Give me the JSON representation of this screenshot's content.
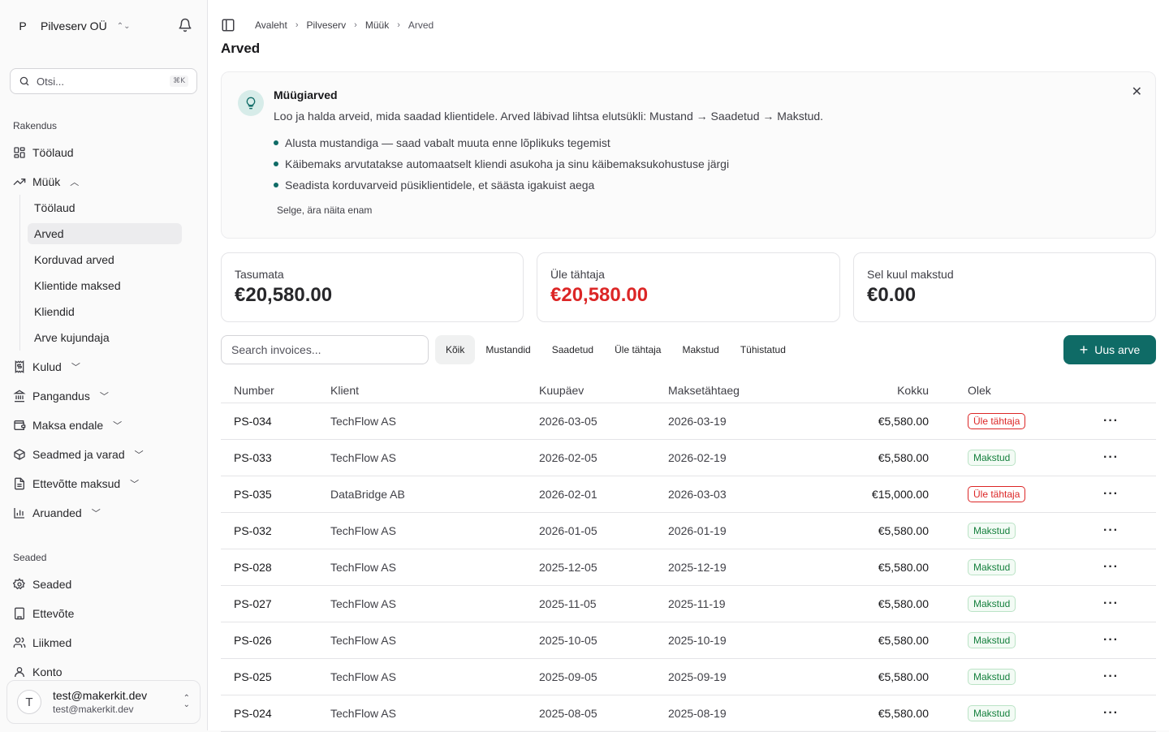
{
  "sidebar": {
    "org": {
      "initial": "P",
      "name": "Pilveserv OÜ"
    },
    "search": {
      "placeholder": "Otsi...",
      "shortcut": "⌘K"
    },
    "section_app": "Rakendus",
    "section_settings": "Seaded",
    "items": [
      {
        "label": "Töölaud",
        "icon": "dashboard-icon"
      },
      {
        "label": "Müük",
        "icon": "trending-up-icon"
      },
      {
        "label": "Kulud",
        "icon": "receipt-icon"
      },
      {
        "label": "Pangandus",
        "icon": "bank-icon"
      },
      {
        "label": "Maksa endale",
        "icon": "wallet-icon"
      },
      {
        "label": "Seadmed ja varad",
        "icon": "box-icon"
      },
      {
        "label": "Ettevõtte maksud",
        "icon": "document-icon"
      },
      {
        "label": "Aruanded",
        "icon": "bar-chart-icon"
      }
    ],
    "sales_sub": [
      {
        "label": "Töölaud"
      },
      {
        "label": "Arved"
      },
      {
        "label": "Korduvad arved"
      },
      {
        "label": "Klientide maksed"
      },
      {
        "label": "Kliendid"
      },
      {
        "label": "Arve kujundaja"
      }
    ],
    "settings_items": [
      {
        "label": "Seaded",
        "icon": "gear-icon"
      },
      {
        "label": "Ettevõte",
        "icon": "building-icon"
      },
      {
        "label": "Liikmed",
        "icon": "users-icon"
      },
      {
        "label": "Konto",
        "icon": "user-icon"
      }
    ],
    "user": {
      "initial": "T",
      "name": "test@makerkit.dev",
      "email": "test@makerkit.dev"
    }
  },
  "breadcrumb": [
    "Avaleht",
    "Pilveserv",
    "Müük",
    "Arved"
  ],
  "page_title": "Arved",
  "banner": {
    "title": "Müügiarved",
    "description": "Loo ja halda arveid, mida saadad klientidele. Arved läbivad lihtsa elutsükli: Mustand → Saadetud → Makstud.",
    "bullets": [
      "Alusta mustandiga — saad vabalt muuta enne lõplikuks tegemist",
      "Käibemaks arvutatakse automaatselt kliendi asukoha ja sinu käibemaksukohustuse järgi",
      "Seadista korduvarveid püsiklientidele, et säästa igakuist aega"
    ],
    "dismiss": "Selge, ära näita enam"
  },
  "stats": [
    {
      "label": "Tasumata",
      "value": "€20,580.00"
    },
    {
      "label": "Üle tähtaja",
      "value": "€20,580.00"
    },
    {
      "label": "Sel kuul makstud",
      "value": "€0.00"
    }
  ],
  "filters": {
    "search_placeholder": "Search invoices...",
    "tabs": [
      "Kõik",
      "Mustandid",
      "Saadetud",
      "Üle tähtaja",
      "Makstud",
      "Tühistatud"
    ],
    "new_button": "Uus arve"
  },
  "table": {
    "columns": [
      "Number",
      "Klient",
      "Kuupäev",
      "Maksetähtaeg",
      "Kokku",
      "Olek"
    ],
    "rows": [
      {
        "number": "PS-034",
        "client": "TechFlow AS",
        "date": "2026-03-05",
        "due": "2026-03-19",
        "total": "€5,580.00",
        "status": "Üle tähtaja"
      },
      {
        "number": "PS-033",
        "client": "TechFlow AS",
        "date": "2026-02-05",
        "due": "2026-02-19",
        "total": "€5,580.00",
        "status": "Makstud"
      },
      {
        "number": "PS-035",
        "client": "DataBridge AB",
        "date": "2026-02-01",
        "due": "2026-03-03",
        "total": "€15,000.00",
        "status": "Üle tähtaja"
      },
      {
        "number": "PS-032",
        "client": "TechFlow AS",
        "date": "2026-01-05",
        "due": "2026-01-19",
        "total": "€5,580.00",
        "status": "Makstud"
      },
      {
        "number": "PS-028",
        "client": "TechFlow AS",
        "date": "2025-12-05",
        "due": "2025-12-19",
        "total": "€5,580.00",
        "status": "Makstud"
      },
      {
        "number": "PS-027",
        "client": "TechFlow AS",
        "date": "2025-11-05",
        "due": "2025-11-19",
        "total": "€5,580.00",
        "status": "Makstud"
      },
      {
        "number": "PS-026",
        "client": "TechFlow AS",
        "date": "2025-10-05",
        "due": "2025-10-19",
        "total": "€5,580.00",
        "status": "Makstud"
      },
      {
        "number": "PS-025",
        "client": "TechFlow AS",
        "date": "2025-09-05",
        "due": "2025-09-19",
        "total": "€5,580.00",
        "status": "Makstud"
      },
      {
        "number": "PS-024",
        "client": "TechFlow AS",
        "date": "2025-08-05",
        "due": "2025-08-19",
        "total": "€5,580.00",
        "status": "Makstud"
      }
    ]
  },
  "colors": {
    "accent": "#0f6b66",
    "overdue": "#dc2626",
    "paid": "#15803d"
  }
}
